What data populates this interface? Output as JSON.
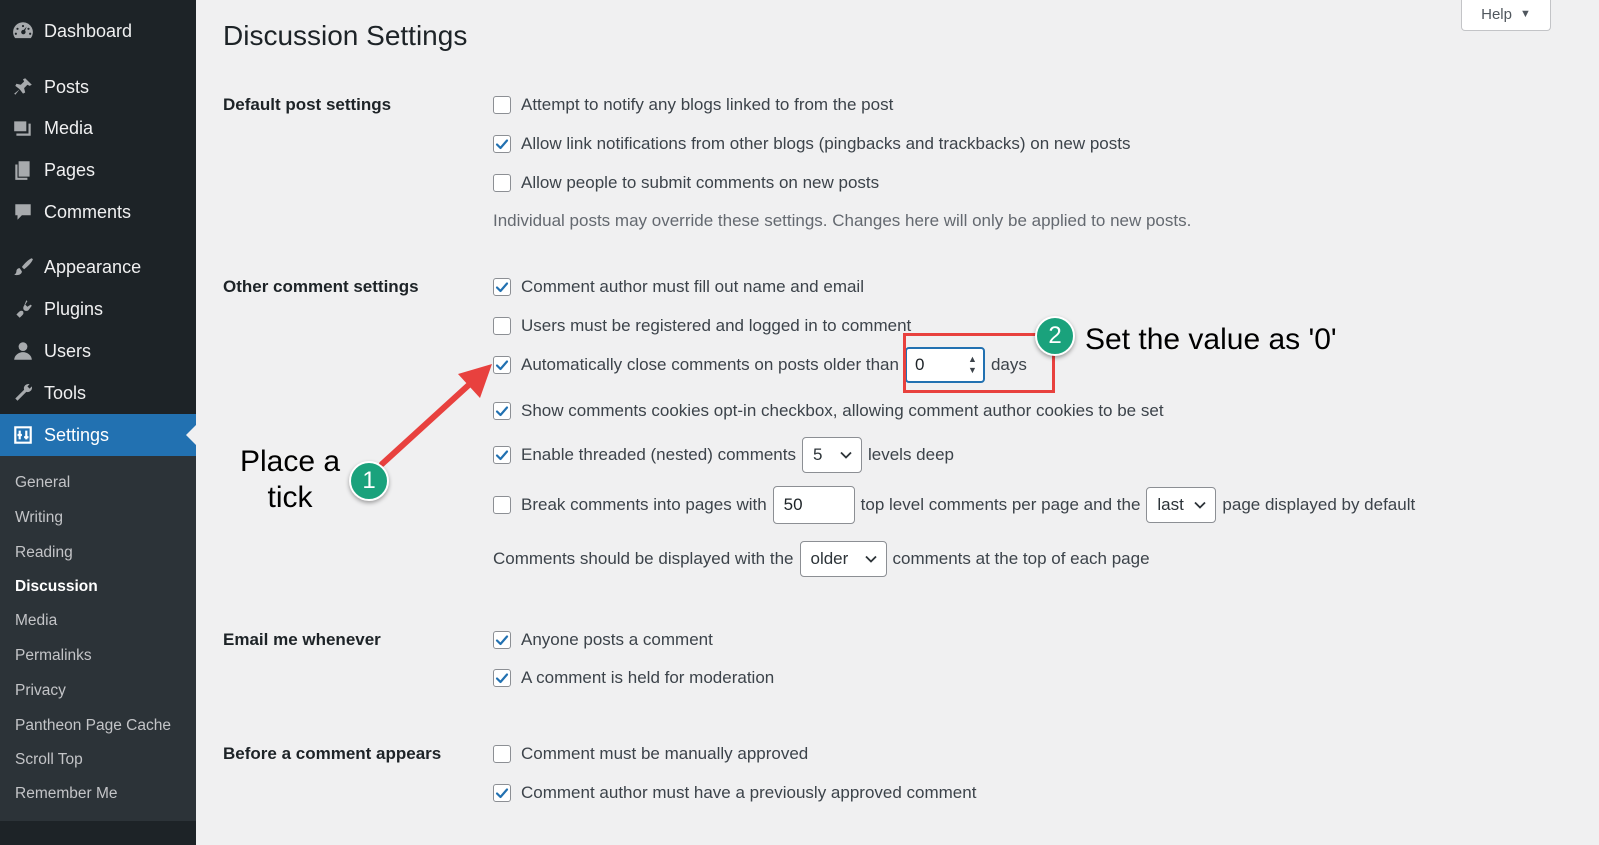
{
  "sidebar": {
    "menu": [
      {
        "label": "Dashboard",
        "icon": "dashboard-icon"
      },
      {
        "label": "Posts",
        "icon": "pin-icon"
      },
      {
        "label": "Media",
        "icon": "media-icon"
      },
      {
        "label": "Pages",
        "icon": "pages-icon"
      },
      {
        "label": "Comments",
        "icon": "comment-icon"
      },
      {
        "label": "Appearance",
        "icon": "paintbrush-icon"
      },
      {
        "label": "Plugins",
        "icon": "plugin-icon"
      },
      {
        "label": "Users",
        "icon": "user-icon"
      },
      {
        "label": "Tools",
        "icon": "wrench-icon"
      },
      {
        "label": "Settings",
        "icon": "settings-icon"
      }
    ],
    "submenu": [
      "General",
      "Writing",
      "Reading",
      "Discussion",
      "Media",
      "Permalinks",
      "Privacy",
      "Pantheon Page Cache",
      "Scroll Top",
      "Remember Me"
    ],
    "current_sub": "Discussion"
  },
  "page": {
    "title": "Discussion Settings"
  },
  "help": {
    "label": "Help"
  },
  "sections": {
    "default_post": {
      "label": "Default post settings",
      "options": [
        {
          "label": "Attempt to notify any blogs linked to from the post",
          "checked": false
        },
        {
          "label": "Allow link notifications from other blogs (pingbacks and trackbacks) on new posts",
          "checked": true
        },
        {
          "label": "Allow people to submit comments on new posts",
          "checked": false
        }
      ],
      "note": "Individual posts may override these settings. Changes here will only be applied to new posts."
    },
    "other": {
      "label": "Other comment settings",
      "author_fill": {
        "label": "Comment author must fill out name and email",
        "checked": true
      },
      "registered": {
        "label": "Users must be registered and logged in to comment",
        "checked": false
      },
      "auto_close": {
        "label": "Automatically close comments on posts older than",
        "checked": true,
        "value": "0",
        "suffix": "days"
      },
      "cookies": {
        "label": "Show comments cookies opt-in checkbox, allowing comment author cookies to be set",
        "checked": true
      },
      "threaded": {
        "label": "Enable threaded (nested) comments",
        "checked": true,
        "value": "5",
        "suffix": "levels deep"
      },
      "paged": {
        "label": "Break comments into pages with",
        "checked": false,
        "value": "50",
        "mid": "top level comments per page and the",
        "select": "last",
        "suffix": "page displayed by default"
      },
      "order": {
        "prefix": "Comments should be displayed with the",
        "select": "older",
        "suffix": "comments at the top of each page"
      }
    },
    "email": {
      "label": "Email me whenever",
      "options": [
        {
          "label": "Anyone posts a comment",
          "checked": true
        },
        {
          "label": "A comment is held for moderation",
          "checked": true
        }
      ]
    },
    "before": {
      "label": "Before a comment appears",
      "options": [
        {
          "label": "Comment must be manually approved",
          "checked": false
        },
        {
          "label": "Comment author must have a previously approved comment",
          "checked": true
        }
      ]
    }
  },
  "annotations": {
    "step1": {
      "number": "1",
      "text_line1": "Place a",
      "text_line2": "tick"
    },
    "step2": {
      "number": "2",
      "text": "Set the value as '0'"
    },
    "colors": {
      "highlight": "#e8413e",
      "badge": "#1aa27c"
    }
  }
}
